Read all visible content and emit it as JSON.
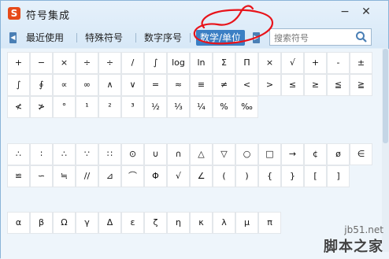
{
  "window": {
    "title": "符号集成",
    "logo_glyph": "S",
    "minimize_glyph": "−",
    "close_glyph": "✕"
  },
  "tabs": {
    "left_arrow": "◀",
    "right_arrow": "▶",
    "items": [
      "最近使用",
      "特殊符号",
      "数字序号",
      "数学/单位"
    ],
    "active": "数学/单位"
  },
  "search": {
    "placeholder": "搜索符号"
  },
  "symbols": {
    "group1": [
      [
        "+",
        "−",
        "×",
        "÷",
        "÷",
        "/",
        "∫",
        "log",
        "ln",
        "Σ",
        "Π",
        "×",
        "√",
        "+",
        "-",
        "±"
      ],
      [
        "∫",
        "∮",
        "∝",
        "∞",
        "∧",
        "∨",
        "=",
        "≈",
        "≡",
        "≠",
        "<",
        ">",
        "≤",
        "≥",
        "≦",
        "≧"
      ],
      [
        "≮",
        "≯",
        "°",
        "¹",
        "²",
        "³",
        "½",
        "⅓",
        "¼",
        "%",
        "‰"
      ]
    ],
    "group2": [
      [
        "∴",
        "∶",
        "∴",
        "∵",
        "∷",
        "⊙",
        "∪",
        "∩",
        "△",
        "▽",
        "○",
        "□",
        "→",
        "¢",
        "ø",
        "∈"
      ],
      [
        "≌",
        "∽",
        "≒",
        "//",
        "⊿",
        "⌒",
        "Φ",
        "√",
        "∠",
        "(",
        ")",
        "{",
        "}",
        "[",
        "]"
      ]
    ],
    "group3": [
      [
        "α",
        "β",
        "Ω",
        "γ",
        "Δ",
        "ε",
        "ζ",
        "η",
        "κ",
        "λ",
        "μ",
        "π"
      ]
    ]
  },
  "watermark": {
    "url": "jb51.net",
    "name": "脚本之家"
  },
  "annotation_color": "#e8131a"
}
